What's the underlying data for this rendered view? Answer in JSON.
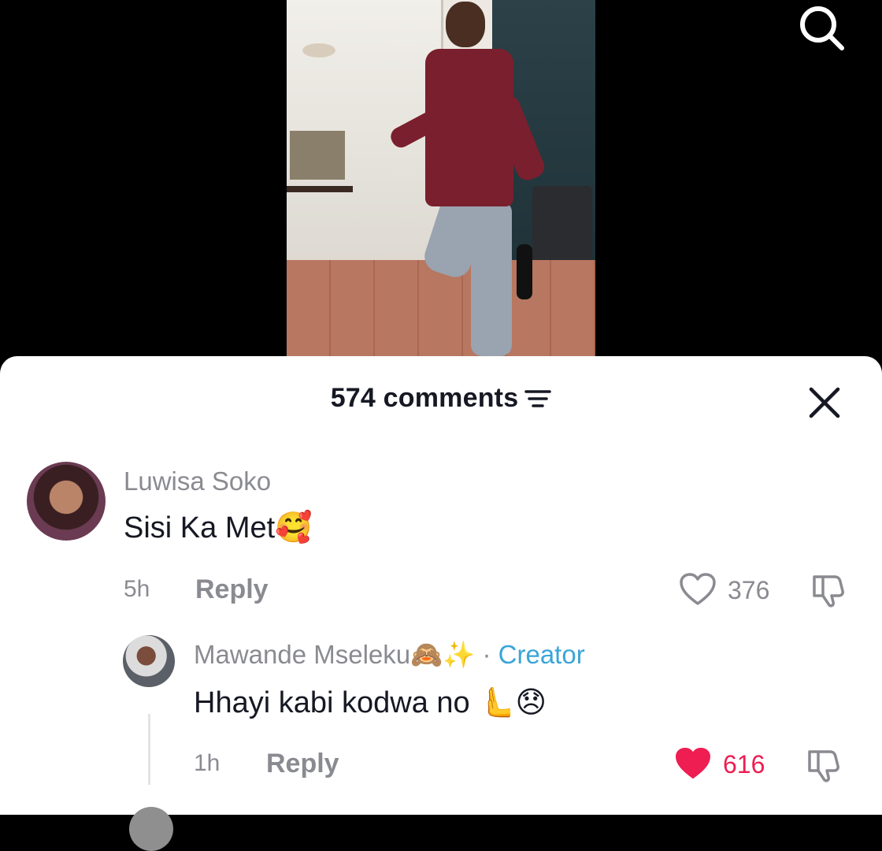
{
  "header": {
    "comments_label": "574 comments"
  },
  "comments": [
    {
      "username": "Luwisa Soko",
      "text": "Sisi Ka Met🥰",
      "time": "5h",
      "reply_label": "Reply",
      "likes": "376",
      "liked": false
    },
    {
      "username": "Mawande Mseleku🙈✨",
      "badge_separator": "·",
      "badge": "Creator",
      "text": "Hhayi kabi kodwa no 🫷😞",
      "time": "1h",
      "reply_label": "Reply",
      "likes": "616",
      "liked": true
    }
  ],
  "colors": {
    "like_active": "#ee1d52",
    "creator_badge": "#3ba5d8",
    "muted_text": "#8a8b91"
  },
  "icons": [
    "search-icon",
    "sort-icon",
    "close-icon",
    "heart-icon",
    "dislike-icon"
  ]
}
